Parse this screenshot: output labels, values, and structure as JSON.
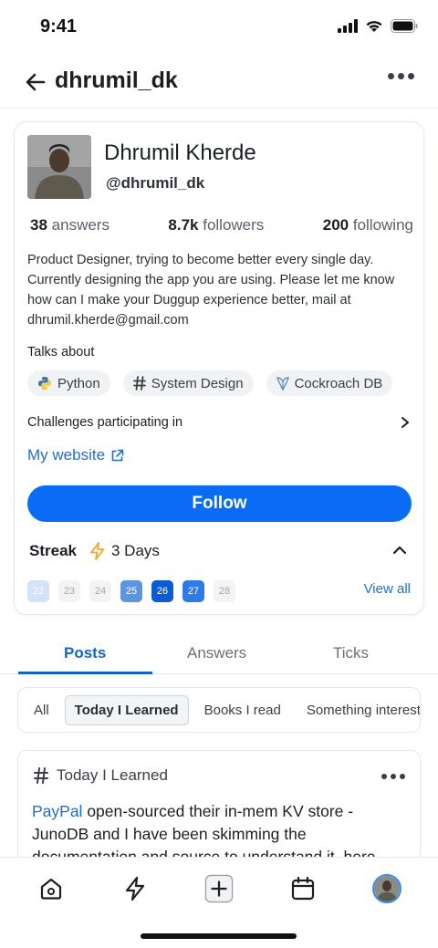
{
  "status_bar": {
    "time": "9:41"
  },
  "header": {
    "title": "dhrumil_dk"
  },
  "profile": {
    "name": "Dhrumil Kherde",
    "handle": "@dhrumil_dk",
    "stats": {
      "answers_count": "38",
      "answers_label": "answers",
      "followers_count": "8.7k",
      "followers_label": "followers",
      "following_count": "200",
      "following_label": "following"
    },
    "bio": "Product Designer, trying to become better every single day. Currently designing the app you are using. Please let me know how can I make your Duggup experience better, mail at dhrumil.kherde@gmail.com",
    "talks_about_label": "Talks about",
    "topics": [
      {
        "label": "Python",
        "icon": "python-icon"
      },
      {
        "label": "System Design",
        "icon": "hash-icon"
      },
      {
        "label": "Cockroach DB",
        "icon": "cockroach-db-icon"
      }
    ],
    "challenges_label": "Challenges participating in",
    "website_label": "My website",
    "follow_label": "Follow",
    "streak": {
      "label": "Streak",
      "value": "3 Days",
      "days": [
        {
          "day": "22",
          "state": "light"
        },
        {
          "day": "23",
          "state": "empty"
        },
        {
          "day": "24",
          "state": "empty"
        },
        {
          "day": "25",
          "state": "mid"
        },
        {
          "day": "26",
          "state": "dark"
        },
        {
          "day": "27",
          "state": "blue"
        },
        {
          "day": "28",
          "state": "empty"
        }
      ],
      "view_all_label": "View all"
    }
  },
  "tabs": [
    {
      "label": "Posts",
      "active": true
    },
    {
      "label": "Answers",
      "active": false
    },
    {
      "label": "Ticks",
      "active": false
    }
  ],
  "filters": [
    "All",
    "Today I Learned",
    "Books I read",
    "Something interesting"
  ],
  "active_filter": "Today I Learned",
  "post": {
    "tag": "Today I Learned",
    "link_text": "PayPal",
    "text": " open-sourced their in-mem KV store - JunoDB and I have been skimming the documentation and source to understand it, here"
  },
  "colors": {
    "accent": "#0a6cf5",
    "link": "#1f6fc9",
    "tab_active": "#1565c0"
  }
}
